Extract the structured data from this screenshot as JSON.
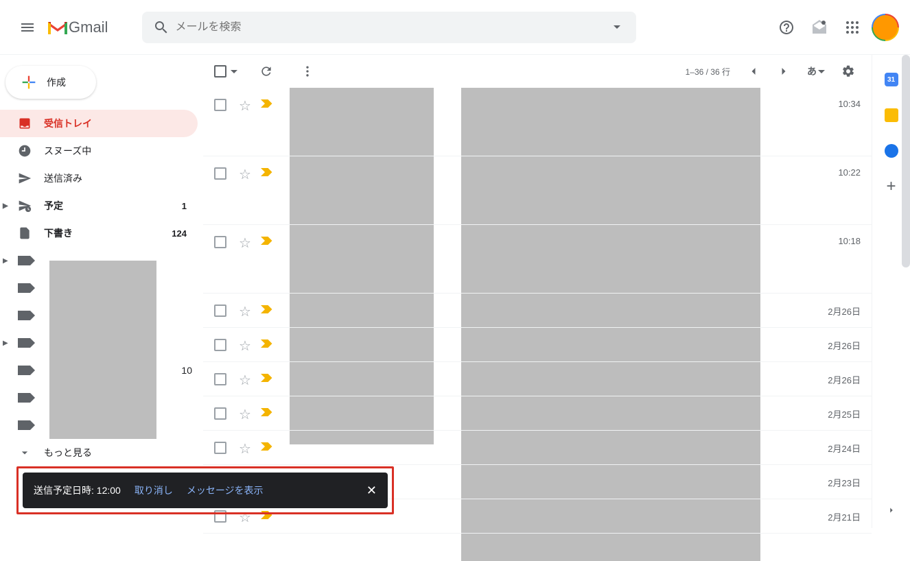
{
  "header": {
    "app_name": "Gmail",
    "search_placeholder": "メールを検索"
  },
  "compose": {
    "label": "作成"
  },
  "nav": {
    "inbox": "受信トレイ",
    "snoozed": "スヌーズ中",
    "sent": "送信済み",
    "scheduled": "予定",
    "scheduled_count": "1",
    "drafts": "下書き",
    "drafts_count": "124",
    "label_count": "10",
    "more": "もっと見る"
  },
  "toolbar": {
    "pagination": "1–36 / 36 行",
    "lang": "あ"
  },
  "calendar_day": "31",
  "emails": [
    {
      "date": "10:34"
    },
    {
      "date": "10:22"
    },
    {
      "date": "10:18"
    },
    {
      "date": "2月26日"
    },
    {
      "date": "2月26日"
    },
    {
      "date": "2月26日"
    },
    {
      "date": "2月25日"
    },
    {
      "date": "2月24日"
    },
    {
      "date": "2月23日"
    },
    {
      "date": "2月21日"
    }
  ],
  "toast": {
    "message": "送信予定日時: 12:00",
    "undo": "取り消し",
    "view": "メッセージを表示"
  }
}
